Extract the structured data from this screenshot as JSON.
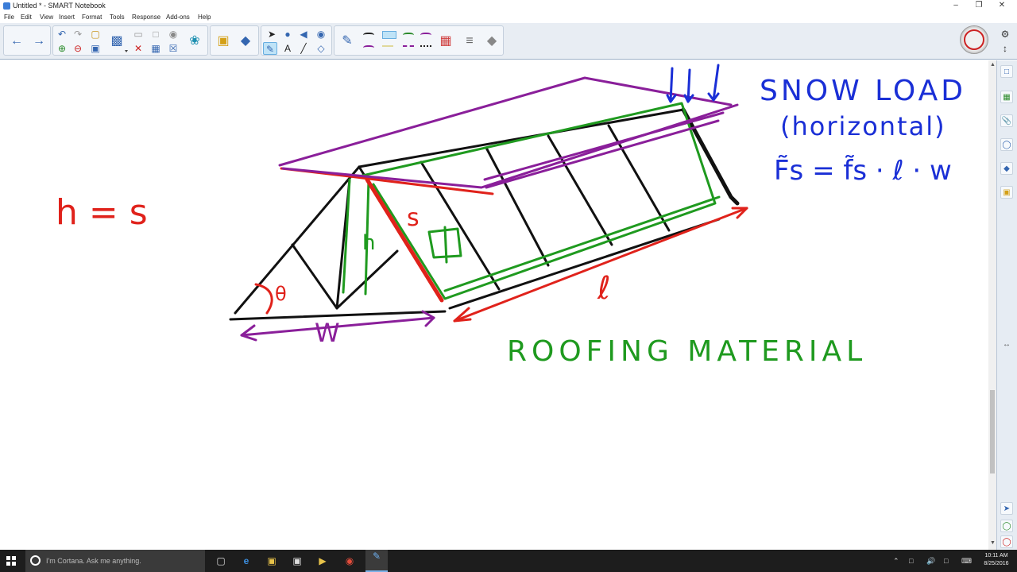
{
  "window": {
    "title": "Untitled * - SMART Notebook",
    "controls": [
      "–",
      "❐",
      "✕"
    ]
  },
  "menu": [
    "File",
    "Edit",
    "View",
    "Insert",
    "Format",
    "Tools",
    "Response",
    "Add-ons",
    "Help"
  ],
  "canvas": {
    "equation_left": "h = s",
    "label_theta": "θ",
    "label_w": "W",
    "label_h": "h",
    "label_s": "s",
    "label_l": "ℓ",
    "title_snow_load": "SNOW LOAD",
    "subtitle_horizontal": "(horizontal)",
    "formula_force": "F̃s = f̃s · ℓ · w",
    "label_roofing": "ROOFING MATERIAL",
    "colors": {
      "black": "#111111",
      "red": "#e0221b",
      "green": "#1f9a1f",
      "purple": "#8a1f9a",
      "blue": "#1a2fd6"
    }
  },
  "taskbar": {
    "search_placeholder": "I'm Cortana. Ask me anything.",
    "time": "10:11 AM",
    "date": "8/25/2016"
  }
}
